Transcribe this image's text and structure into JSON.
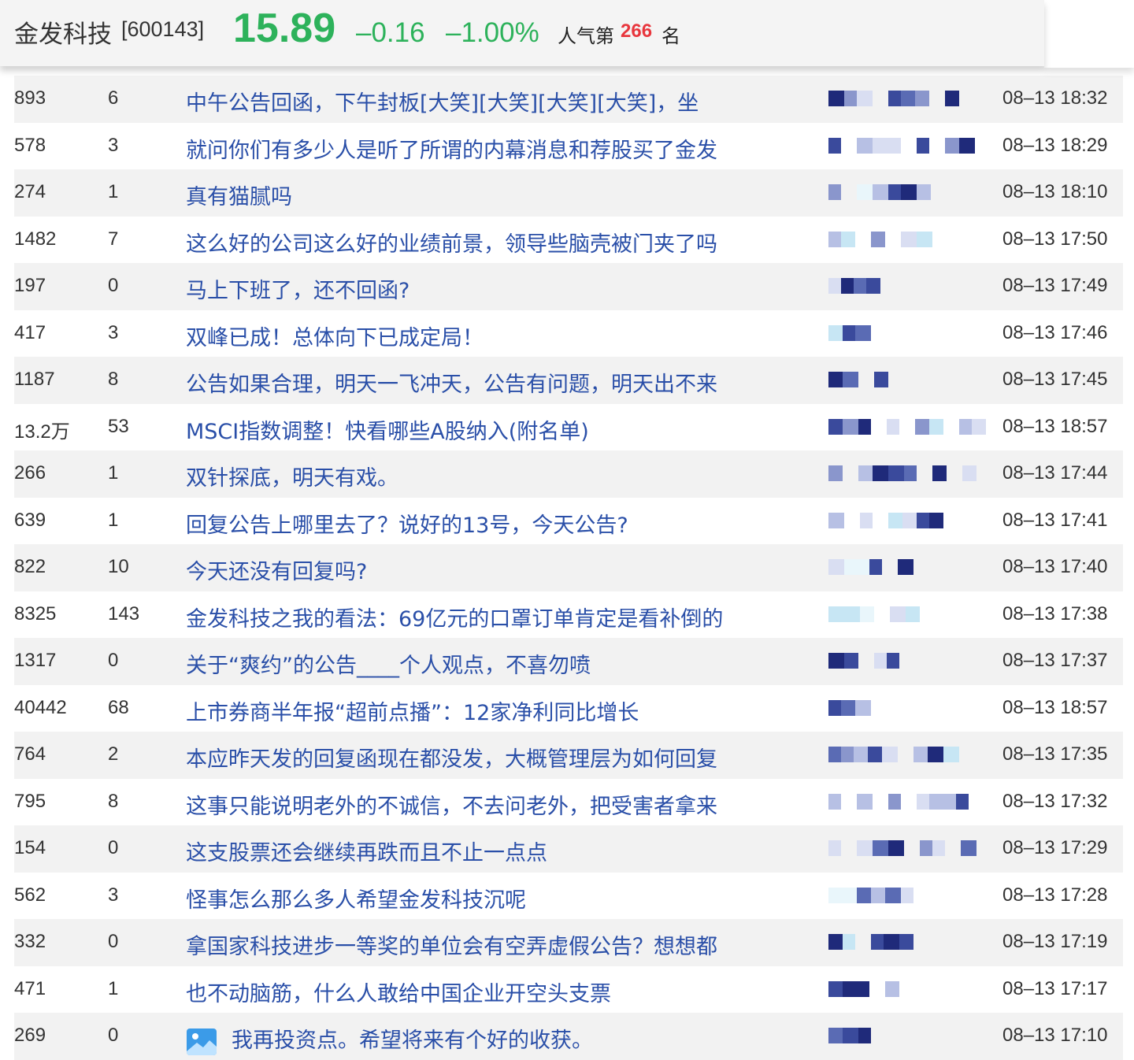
{
  "header": {
    "stock_name": "金发科技",
    "stock_code": "[600143]",
    "price": "15.89",
    "change": "–0.16",
    "change_pct": "–1.00%",
    "rank_label": "人气第",
    "rank_value": "266",
    "rank_unit": "名",
    "down_color": "#2db25b",
    "rank_color": "#e8363d"
  },
  "posts": [
    {
      "reads": "893",
      "replies": "6",
      "title": "中午公告回函，下午封板[大笑][大笑][大笑][大笑]，坐",
      "time": "08–13 18:32"
    },
    {
      "reads": "578",
      "replies": "3",
      "title": "就问你们有多少人是听了所谓的内幕消息和荐股买了金发",
      "time": "08–13 18:29"
    },
    {
      "reads": "274",
      "replies": "1",
      "title": "真有猫腻吗",
      "time": "08–13 18:10"
    },
    {
      "reads": "1482",
      "replies": "7",
      "title": "这么好的公司这么好的业绩前景，领导些脑壳被门夹了吗",
      "time": "08–13 17:50"
    },
    {
      "reads": "197",
      "replies": "0",
      "title": "马上下班了，还不回函?",
      "time": "08–13 17:49"
    },
    {
      "reads": "417",
      "replies": "3",
      "title": "双峰已成！总体向下已成定局！",
      "time": "08–13 17:46"
    },
    {
      "reads": "1187",
      "replies": "8",
      "title": "公告如果合理，明天一飞冲天，公告有问题，明天出不来",
      "time": "08–13 17:45"
    },
    {
      "reads": "13.2万",
      "replies": "53",
      "title": "MSCI指数调整！快看哪些A股纳入(附名单)",
      "time": "08–13 18:57"
    },
    {
      "reads": "266",
      "replies": "1",
      "title": "双针探底，明天有戏。",
      "time": "08–13 17:44"
    },
    {
      "reads": "639",
      "replies": "1",
      "title": "回复公告上哪里去了？说好的13号，今天公告?",
      "time": "08–13 17:41"
    },
    {
      "reads": "822",
      "replies": "10",
      "title": "今天还没有回复吗?",
      "time": "08–13 17:40"
    },
    {
      "reads": "8325",
      "replies": "143",
      "title": "金发科技之我的看法：69亿元的口罩订单肯定是看补倒的",
      "time": "08–13 17:38"
    },
    {
      "reads": "1317",
      "replies": "0",
      "title": "关于“爽约”的公告____个人观点，不喜勿喷",
      "time": "08–13 17:37"
    },
    {
      "reads": "40442",
      "replies": "68",
      "title": "上市券商半年报“超前点播”：12家净利同比增长",
      "time": "08–13 18:57"
    },
    {
      "reads": "764",
      "replies": "2",
      "title": "本应昨天发的回复函现在都没发，大概管理层为如何回复",
      "time": "08–13 17:35"
    },
    {
      "reads": "795",
      "replies": "8",
      "title": "这事只能说明老外的不诚信，不去问老外，把受害者拿来",
      "time": "08–13 17:32"
    },
    {
      "reads": "154",
      "replies": "0",
      "title": "这支股票还会继续再跌而且不止一点点",
      "time": "08–13 17:29"
    },
    {
      "reads": "562",
      "replies": "3",
      "title": "怪事怎么那么多人希望金发科技沉呢",
      "time": "08–13 17:28"
    },
    {
      "reads": "332",
      "replies": "0",
      "title": "拿国家科技进步一等奖的单位会有空弄虚假公告？想想都",
      "time": "08–13 17:19"
    },
    {
      "reads": "471",
      "replies": "1",
      "title": "也不动脑筋，什么人敢给中国企业开空头支票",
      "time": "08–13 17:17"
    },
    {
      "reads": "269",
      "replies": "0",
      "title": "我再投资点。希望将来有个好的收获。",
      "time": "08–13 17:10",
      "has_image_icon": true
    }
  ]
}
